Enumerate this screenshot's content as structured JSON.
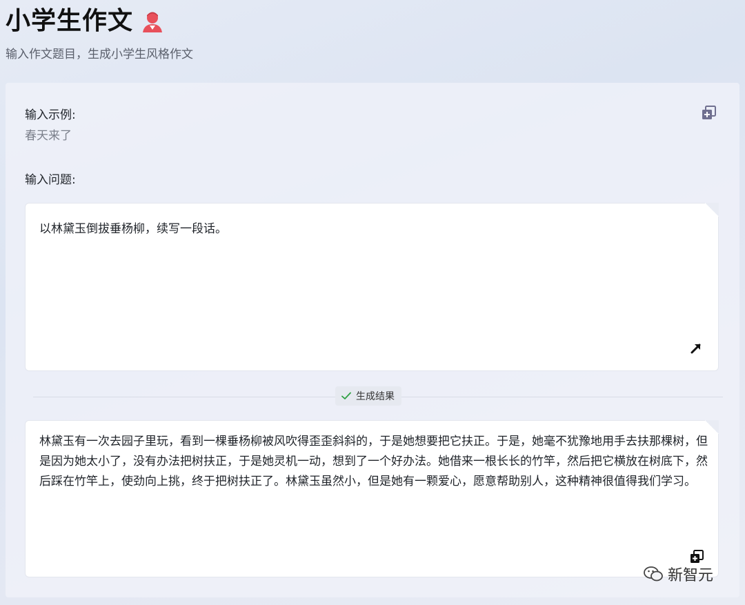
{
  "header": {
    "title": "小学生作文",
    "subtitle": "输入作文题目，生成小学生风格作文"
  },
  "example": {
    "label": "输入示例:",
    "value": "春天来了"
  },
  "question": {
    "label": "输入问题:",
    "value": "以林黛玉倒拔垂杨柳，续写一段话。"
  },
  "divider": {
    "badge": "生成结果"
  },
  "result": {
    "text": "林黛玉有一次去园子里玩，看到一棵垂杨柳被风吹得歪歪斜斜的，于是她想要把它扶正。于是，她毫不犹豫地用手去扶那棵树，但是因为她太小了，没有办法把树扶正，于是她灵机一动，想到了一个好办法。她借来一根长长的竹竿，然后把它横放在树底下，然后踩在竹竿上，使劲向上挑，终于把树扶正了。林黛玉虽然小，但是她有一颗爱心，愿意帮助别人，这种精神很值得我们学习。"
  },
  "footer": {
    "brand": "新智元"
  },
  "icons": {
    "avatar": "avatar-icon",
    "copy": "copy-icon",
    "expand": "expand-arrow-icon",
    "check": "check-icon",
    "wechat": "wechat-icon"
  },
  "colors": {
    "avatar": "#e8505b",
    "check": "#2ea043",
    "copy": "#6f6f8f"
  }
}
